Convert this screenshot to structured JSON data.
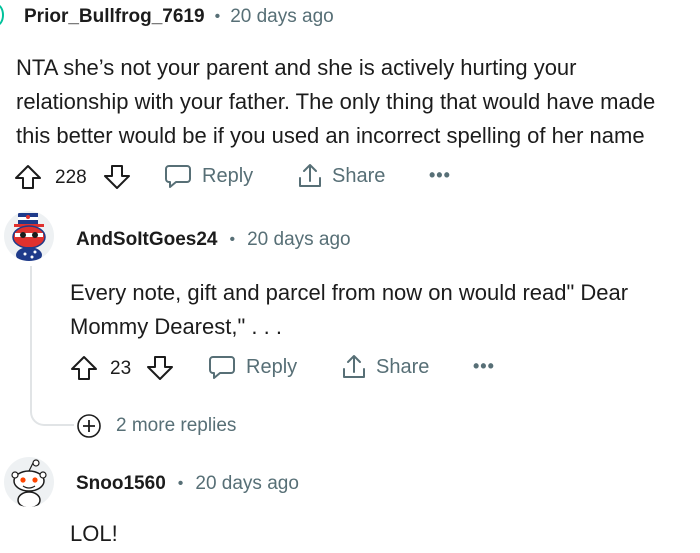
{
  "comments": [
    {
      "username": "Prior_Bullfrog_7619",
      "separator": "•",
      "time": "20 days ago",
      "lines": [
        "NTA she’s not your parent and she is actively hurting your",
        "relationship with your father. The only thing that would have made",
        "this better would be if you used an incorrect spelling of her name"
      ],
      "votes": "228",
      "reply_label": "Reply",
      "share_label": "Share",
      "more_label": "•••"
    },
    {
      "username": "AndSoItGoes24",
      "separator": "•",
      "time": "20 days ago",
      "lines": [
        "Every note, gift and parcel from now on would read\" Dear",
        "Mommy Dearest,\" . . ."
      ],
      "votes": "23",
      "reply_label": "Reply",
      "share_label": "Share",
      "more_label": "•••",
      "more_replies_label": "2 more replies"
    },
    {
      "username": "Snoo1560",
      "separator": "•",
      "time": "20 days ago",
      "lines": [
        "LOL!"
      ]
    }
  ],
  "colors": {
    "text": "#1c1c1c",
    "meta": "#576f76",
    "thread_line": "#e1e4e6",
    "avatar_ring": "#00c29b"
  }
}
